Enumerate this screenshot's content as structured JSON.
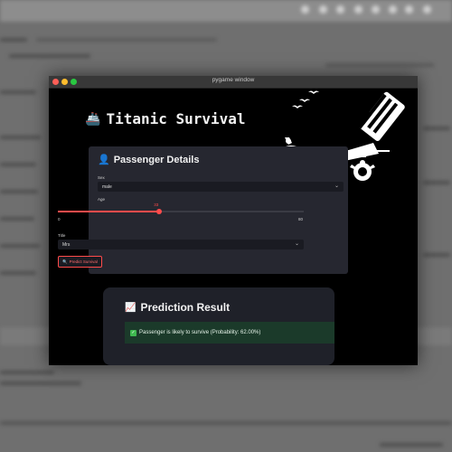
{
  "window": {
    "title": "pygame window"
  },
  "app": {
    "title": "Titanic Survival",
    "title_icon": "ship-icon"
  },
  "passenger_panel": {
    "title": "Passenger Details",
    "icon": "person-icon",
    "sex": {
      "label": "Sex",
      "value": "male"
    },
    "age": {
      "label": "Age",
      "value": "33",
      "min": "0",
      "max": "80",
      "fraction": 0.4125
    },
    "title_field": {
      "label": "Title",
      "value": "Mrs"
    },
    "predict_button": {
      "label": "Predict Survival",
      "icon": "magnifier-icon"
    }
  },
  "prediction": {
    "title": "Prediction Result",
    "icon": "chart-icon",
    "message": "Passenger is likely to survive (Probability: 62.00%)",
    "status_icon": "check-icon"
  },
  "colors": {
    "accent": "#ff4b4b",
    "success_bg": "#1b3a2a",
    "panel_bg": "#262730"
  }
}
